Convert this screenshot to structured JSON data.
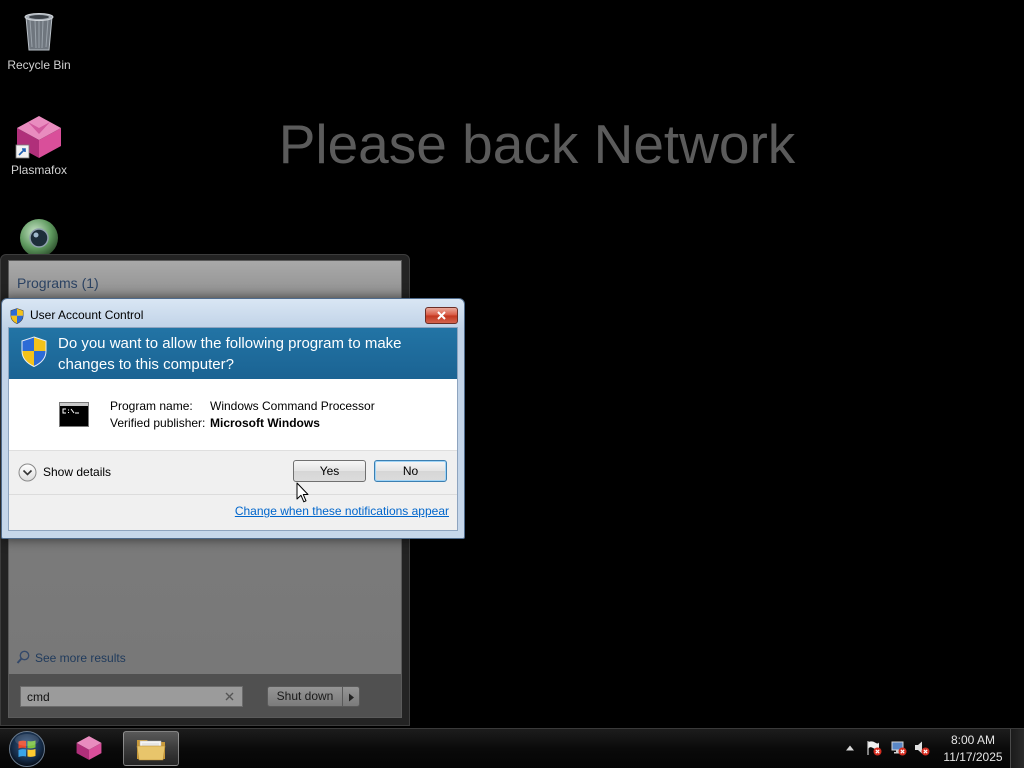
{
  "colors": {
    "desktop_bg": "#000000",
    "uac_header": "#2274a5",
    "link": "#0066cc"
  },
  "desktop": {
    "wallpaper_text": "Please back Network",
    "icons": [
      {
        "label": "Recycle Bin",
        "icon": "recycle-bin-icon"
      },
      {
        "label": "Plasmafox",
        "icon": "plasmafox-icon"
      },
      {
        "icon": "webcam-icon"
      }
    ]
  },
  "start_menu": {
    "programs_header": "Programs (1)",
    "see_more": "See more results",
    "search": {
      "value": "cmd",
      "icon": "search-icon",
      "clear_icon": "clear-search-icon"
    },
    "shutdown": {
      "label": "Shut down",
      "arrow_icon": "chevron-right-icon"
    }
  },
  "uac": {
    "title": "User Account Control",
    "title_icon": "uac-shield-icon",
    "question": "Do you want to allow the following program to make changes to this computer?",
    "program_icon": "command-prompt-icon",
    "program_name_label": "Program name:",
    "program_name": "Windows Command Processor",
    "publisher_label": "Verified publisher:",
    "publisher": "Microsoft Windows",
    "show_details": "Show details",
    "yes_label": "Yes",
    "no_label": "No",
    "settings_link": "Change when these notifications appear"
  },
  "taskbar": {
    "start_icon": "windows-start-orb-icon",
    "buttons": [
      {
        "icon": "plasmafox-icon",
        "active": false
      },
      {
        "icon": "windows-explorer-folder-icon",
        "active": true
      }
    ],
    "tray": {
      "icons": [
        "show-hidden-icons-icon",
        "action-center-icon",
        "network-icon",
        "volume-muted-icon"
      ],
      "time": "8:00 AM",
      "date": "11/17/2025"
    }
  }
}
